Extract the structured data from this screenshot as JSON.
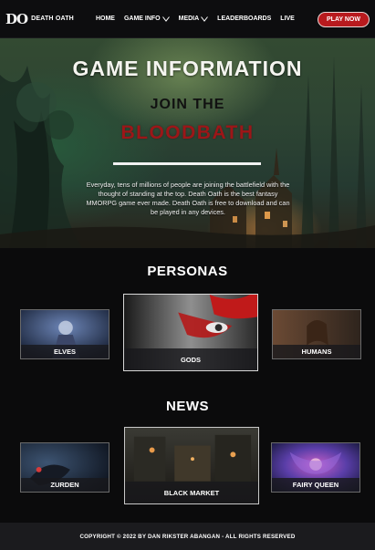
{
  "nav": {
    "logo_mark": "DO",
    "logo_text": "DEATH OATH",
    "items": [
      {
        "label": "HOME",
        "dropdown": false
      },
      {
        "label": "GAME INFO",
        "dropdown": true
      },
      {
        "label": "MEDIA",
        "dropdown": true
      },
      {
        "label": "LEADERBOARDS",
        "dropdown": false
      },
      {
        "label": "LIVE",
        "dropdown": false
      }
    ],
    "play_button": "PLAY NOW"
  },
  "hero": {
    "title": "GAME INFORMATION",
    "subtitle": "JOIN THE",
    "accent": "BLOODBATH",
    "description": "Everyday, tens of millions of people are joining the battlefield with the thought of standing at the top. Death Oath is the best fantasy MMORPG game ever made. Death Oath is free to download and can be  played in any devices."
  },
  "personas": {
    "title": "PERSONAS",
    "cards": [
      {
        "label": "ELVES"
      },
      {
        "label": "GODS"
      },
      {
        "label": "HUMANS"
      }
    ]
  },
  "news": {
    "title": "NEWS",
    "cards": [
      {
        "label": "ZURDEN"
      },
      {
        "label": "BLACK MARKET"
      },
      {
        "label": "FAIRY QUEEN"
      }
    ]
  },
  "footer": {
    "text": "COPYRIGHT © 2022 BY DAN RIKSTER ABANGAN - ALL RIGHTS RESERVED"
  },
  "colors": {
    "accent_red": "#b81a1e",
    "blood_red": "#9c1618",
    "background": "#0b0b0c"
  }
}
